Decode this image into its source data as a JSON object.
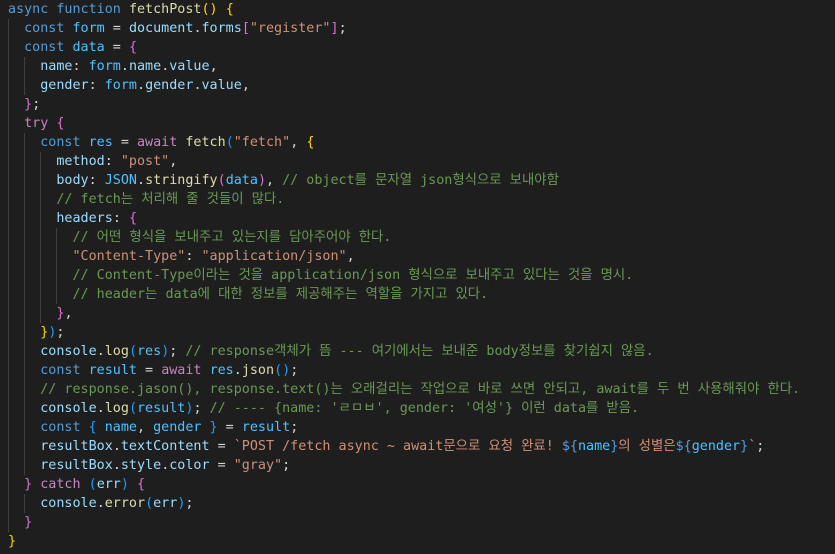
{
  "editor": {
    "language": "javascript",
    "theme_colors": {
      "background": "#1e1e1e",
      "keyword": "#569cd6",
      "control": "#c586c0",
      "function": "#dcdcaa",
      "variable": "#9cdcfe",
      "string": "#ce9178",
      "comment": "#6a9955",
      "bracket_1": "#ffd700",
      "bracket_2": "#da70d6",
      "bracket_3": "#179fff"
    },
    "lines": [
      {
        "indent": 0,
        "tokens": [
          [
            "kw",
            "async "
          ],
          [
            "kw",
            "function "
          ],
          [
            "fn",
            "fetchPost"
          ],
          [
            "b1",
            "()"
          ],
          [
            "pun",
            " "
          ],
          [
            "b1",
            "{"
          ]
        ]
      },
      {
        "indent": 1,
        "tokens": [
          [
            "kw",
            "const "
          ],
          [
            "cst",
            "form"
          ],
          [
            "pun",
            " = "
          ],
          [
            "var",
            "document"
          ],
          [
            "pun",
            "."
          ],
          [
            "var",
            "forms"
          ],
          [
            "b2",
            "["
          ],
          [
            "str",
            "\"register\""
          ],
          [
            "b2",
            "]"
          ],
          [
            "pun",
            ";"
          ]
        ]
      },
      {
        "indent": 1,
        "tokens": [
          [
            "kw",
            "const "
          ],
          [
            "cst",
            "data"
          ],
          [
            "pun",
            " = "
          ],
          [
            "b2",
            "{"
          ]
        ]
      },
      {
        "indent": 2,
        "tokens": [
          [
            "var",
            "name"
          ],
          [
            "pun",
            ": "
          ],
          [
            "cst",
            "form"
          ],
          [
            "pun",
            "."
          ],
          [
            "var",
            "name"
          ],
          [
            "pun",
            "."
          ],
          [
            "var",
            "value"
          ],
          [
            "pun",
            ","
          ]
        ]
      },
      {
        "indent": 2,
        "tokens": [
          [
            "var",
            "gender"
          ],
          [
            "pun",
            ": "
          ],
          [
            "cst",
            "form"
          ],
          [
            "pun",
            "."
          ],
          [
            "var",
            "gender"
          ],
          [
            "pun",
            "."
          ],
          [
            "var",
            "value"
          ],
          [
            "pun",
            ","
          ]
        ]
      },
      {
        "indent": 1,
        "tokens": [
          [
            "b2",
            "}"
          ],
          [
            "pun",
            ";"
          ]
        ]
      },
      {
        "indent": 1,
        "tokens": [
          [
            "ctl",
            "try "
          ],
          [
            "b2",
            "{"
          ]
        ]
      },
      {
        "indent": 2,
        "tokens": [
          [
            "kw",
            "const "
          ],
          [
            "cst",
            "res"
          ],
          [
            "pun",
            " = "
          ],
          [
            "ctl",
            "await "
          ],
          [
            "fn",
            "fetch"
          ],
          [
            "b3",
            "("
          ],
          [
            "str",
            "\"fetch\""
          ],
          [
            "pun",
            ", "
          ],
          [
            "b1",
            "{"
          ]
        ]
      },
      {
        "indent": 3,
        "tokens": [
          [
            "var",
            "method"
          ],
          [
            "pun",
            ": "
          ],
          [
            "str",
            "\"post\""
          ],
          [
            "pun",
            ","
          ]
        ]
      },
      {
        "indent": 3,
        "tokens": [
          [
            "var",
            "body"
          ],
          [
            "pun",
            ": "
          ],
          [
            "cst",
            "JSON"
          ],
          [
            "pun",
            "."
          ],
          [
            "fn",
            "stringify"
          ],
          [
            "b2",
            "("
          ],
          [
            "cst",
            "data"
          ],
          [
            "b2",
            ")"
          ],
          [
            "pun",
            ", "
          ],
          [
            "cmt",
            "// object를 문자열 json형식으로 보내야함"
          ]
        ]
      },
      {
        "indent": 3,
        "tokens": [
          [
            "cmt",
            "// fetch는 처리해 줄 것들이 많다."
          ]
        ]
      },
      {
        "indent": 3,
        "tokens": [
          [
            "var",
            "headers"
          ],
          [
            "pun",
            ": "
          ],
          [
            "b2",
            "{"
          ]
        ]
      },
      {
        "indent": 4,
        "tokens": [
          [
            "cmt",
            "// 어떤 형식을 보내주고 있는지를 담아주어야 한다."
          ]
        ]
      },
      {
        "indent": 4,
        "tokens": [
          [
            "str",
            "\"Content-Type\""
          ],
          [
            "pun",
            ": "
          ],
          [
            "str",
            "\"application/json\""
          ],
          [
            "pun",
            ","
          ]
        ]
      },
      {
        "indent": 4,
        "tokens": [
          [
            "cmt",
            "// Content-Type이라는 것을 application/json 형식으로 보내주고 있다는 것을 명시."
          ]
        ]
      },
      {
        "indent": 4,
        "tokens": [
          [
            "cmt",
            "// header는 data에 대한 정보를 제공해주는 역할을 가지고 있다."
          ]
        ]
      },
      {
        "indent": 3,
        "tokens": [
          [
            "b2",
            "}"
          ],
          [
            "pun",
            ","
          ]
        ]
      },
      {
        "indent": 2,
        "tokens": [
          [
            "b1",
            "}"
          ],
          [
            "b3",
            ")"
          ],
          [
            "pun",
            ";"
          ]
        ]
      },
      {
        "indent": 2,
        "tokens": [
          [
            "var",
            "console"
          ],
          [
            "pun",
            "."
          ],
          [
            "fn",
            "log"
          ],
          [
            "b3",
            "("
          ],
          [
            "cst",
            "res"
          ],
          [
            "b3",
            ")"
          ],
          [
            "pun",
            "; "
          ],
          [
            "cmt",
            "// response객체가 뜸 --- 여기에서는 보내준 body정보를 찾기쉽지 않음."
          ]
        ]
      },
      {
        "indent": 2,
        "tokens": [
          [
            "kw",
            "const "
          ],
          [
            "cst",
            "result"
          ],
          [
            "pun",
            " = "
          ],
          [
            "ctl",
            "await "
          ],
          [
            "cst",
            "res"
          ],
          [
            "pun",
            "."
          ],
          [
            "fn",
            "json"
          ],
          [
            "b3",
            "()"
          ],
          [
            "pun",
            ";"
          ]
        ]
      },
      {
        "indent": 2,
        "tokens": [
          [
            "cmt",
            "// response.jason(), response.text()는 오래걸리는 작업으로 바로 쓰면 안되고, await를 두 번 사용해줘야 한다."
          ]
        ]
      },
      {
        "indent": 2,
        "tokens": [
          [
            "var",
            "console"
          ],
          [
            "pun",
            "."
          ],
          [
            "fn",
            "log"
          ],
          [
            "b3",
            "("
          ],
          [
            "cst",
            "result"
          ],
          [
            "b3",
            ")"
          ],
          [
            "pun",
            "; "
          ],
          [
            "cmt",
            "// ---- {name: 'ㄹㅁㅂ', gender: '여성'} 이런 data를 받음."
          ]
        ]
      },
      {
        "indent": 2,
        "tokens": [
          [
            "kw",
            "const "
          ],
          [
            "b3",
            "{ "
          ],
          [
            "cst",
            "name"
          ],
          [
            "pun",
            ", "
          ],
          [
            "cst",
            "gender"
          ],
          [
            "b3",
            " }"
          ],
          [
            "pun",
            " = "
          ],
          [
            "cst",
            "result"
          ],
          [
            "pun",
            ";"
          ]
        ]
      },
      {
        "indent": 2,
        "tokens": [
          [
            "var",
            "resultBox"
          ],
          [
            "pun",
            "."
          ],
          [
            "var",
            "textContent"
          ],
          [
            "pun",
            " = "
          ],
          [
            "str",
            "`POST /fetch async ~ await문으로 요청 완료! "
          ],
          [
            "kw",
            "${"
          ],
          [
            "cst",
            "name"
          ],
          [
            "kw",
            "}"
          ],
          [
            "str",
            "의 성별은"
          ],
          [
            "kw",
            "${"
          ],
          [
            "cst",
            "gender"
          ],
          [
            "kw",
            "}"
          ],
          [
            "str",
            "`"
          ],
          [
            "pun",
            ";"
          ]
        ]
      },
      {
        "indent": 2,
        "tokens": [
          [
            "var",
            "resultBox"
          ],
          [
            "pun",
            "."
          ],
          [
            "var",
            "style"
          ],
          [
            "pun",
            "."
          ],
          [
            "var",
            "color"
          ],
          [
            "pun",
            " = "
          ],
          [
            "str",
            "\"gray\""
          ],
          [
            "pun",
            ";"
          ]
        ]
      },
      {
        "indent": 1,
        "tokens": [
          [
            "b2",
            "}"
          ],
          [
            "pun",
            " "
          ],
          [
            "ctl",
            "catch "
          ],
          [
            "b3",
            "("
          ],
          [
            "var",
            "err"
          ],
          [
            "b3",
            ")"
          ],
          [
            "pun",
            " "
          ],
          [
            "b2",
            "{"
          ]
        ]
      },
      {
        "indent": 2,
        "tokens": [
          [
            "var",
            "console"
          ],
          [
            "pun",
            "."
          ],
          [
            "fn",
            "error"
          ],
          [
            "b3",
            "("
          ],
          [
            "var",
            "err"
          ],
          [
            "b3",
            ")"
          ],
          [
            "pun",
            ";"
          ]
        ]
      },
      {
        "indent": 1,
        "tokens": [
          [
            "b2",
            "}"
          ]
        ]
      },
      {
        "indent": 0,
        "tokens": [
          [
            "b1",
            "}"
          ]
        ]
      }
    ]
  }
}
